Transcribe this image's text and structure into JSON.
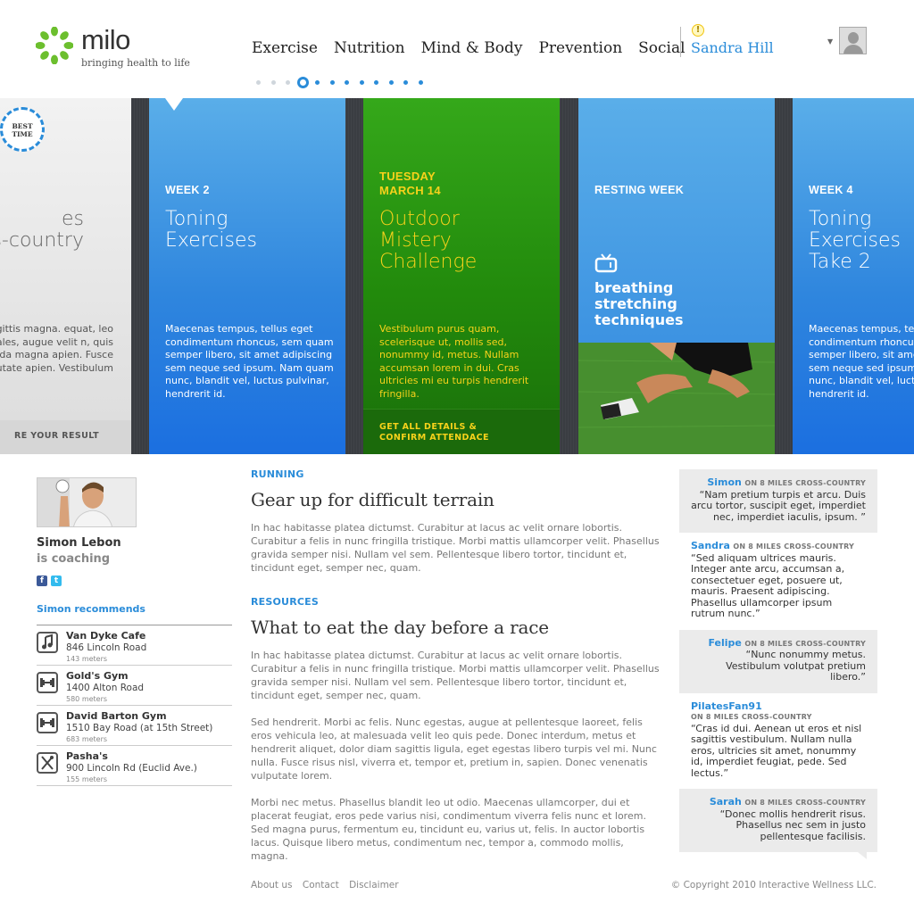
{
  "brand": {
    "name": "milo",
    "tagline": "bringing health to life",
    "accent": "#2a8cd9",
    "green": "#3aa315",
    "yellow": "#f7d21b"
  },
  "nav": {
    "items": [
      "Exercise",
      "Nutrition",
      "Mind & Body",
      "Prevention",
      "Social"
    ],
    "alert_icon": "warning-icon"
  },
  "user": {
    "name": "Sandra Hill"
  },
  "pager": {
    "total": 12,
    "current_index": 3
  },
  "carousel": {
    "cards": [
      {
        "badge": "BEST TIME",
        "title_line1": "es",
        "title_line2": "s-country",
        "desc": "dales sagittis magna. equat, leo eget o sodales, augue velit n, quis gravida magna apien. Fusce vulputate apien. Vestibulum",
        "footer": "RE YOUR RESULT"
      },
      {
        "label": "WEEK 2",
        "title": "Toning Exercises",
        "desc": "Maecenas tempus, tellus eget condimentum rhoncus, sem quam semper libero, sit amet adipiscing sem neque sed ipsum. Nam quam nunc, blandit vel, luctus pulvinar, hendrerit id."
      },
      {
        "label_line1": "TUESDAY",
        "label_line2": "MARCH 14",
        "title": "Outdoor Mistery Challenge",
        "desc": "Vestibulum purus quam, scelerisque ut, mollis sed, nonummy id, metus. Nullam accumsan lorem in dui. Cras ultricies mi eu turpis hendrerit fringilla.",
        "footer_line1": "GET ALL DETAILS &",
        "footer_line2": "CONFIRM ATTENDACE"
      },
      {
        "label": "RESTING WEEK",
        "title": "breathing stretching techniques",
        "icon": "tv-icon"
      },
      {
        "label": "WEEK 4",
        "title": "Toning Exercises Take 2",
        "desc": "Maecenas tempus, tellus eget condimentum rhoncus, sem quam semper libero, sit amet adipiscing sem neque sed ipsum. Nam quam nunc, blandit vel, luctus pulvinar, hendrerit id."
      }
    ]
  },
  "coach": {
    "name": "Simon Lebon",
    "role": "is coaching",
    "social": [
      "facebook-icon",
      "twitter-icon"
    ]
  },
  "recommendations": {
    "title": "Simon recommends",
    "items": [
      {
        "icon": "music-icon",
        "name": "Van Dyke Cafe",
        "address": "846 Lincoln Road",
        "distance": "143 meters"
      },
      {
        "icon": "dumbbell-icon",
        "name": "Gold's Gym",
        "address": "1400 Alton Road",
        "distance": "580 meters"
      },
      {
        "icon": "dumbbell-icon",
        "name": "David Barton Gym",
        "address": "1510 Bay Road (at 15th Street)",
        "distance": "683 meters"
      },
      {
        "icon": "utensils-icon",
        "name": "Pasha's",
        "address": "900 Lincoln Rd (Euclid Ave.)",
        "distance": "155 meters"
      }
    ]
  },
  "articles": [
    {
      "label": "RUNNING",
      "title": "Gear up for difficult terrain",
      "paragraphs": [
        "In hac habitasse platea dictumst. Curabitur at lacus ac velit ornare lobortis. Curabitur a felis in nunc fringilla tristique. Morbi mattis ullamcorper velit. Phasellus gravida semper nisi. Nullam vel sem. Pellentesque libero tortor, tincidunt et, tincidunt eget, semper nec, quam."
      ]
    },
    {
      "label": "RESOURCES",
      "title": "What to eat the day before a race",
      "paragraphs": [
        "In hac habitasse platea dictumst. Curabitur at lacus ac velit ornare lobortis. Curabitur a felis in nunc fringilla tristique. Morbi mattis ullamcorper velit. Phasellus gravida semper nisi. Nullam vel sem. Pellentesque libero tortor, tincidunt et, tincidunt eget, semper nec, quam.",
        "Sed hendrerit. Morbi ac felis. Nunc egestas, augue at pellentesque laoreet, felis eros vehicula leo, at malesuada velit leo quis pede. Donec interdum, metus et hendrerit aliquet, dolor diam sagittis ligula, eget egestas libero turpis vel mi. Nunc nulla. Fusce risus nisl, viverra et, tempor et, pretium in, sapien. Donec venenatis vulputate lorem.",
        "Morbi nec metus. Phasellus blandit leo ut odio. Maecenas ullamcorper, dui et placerat feugiat, eros pede varius nisi, condimentum viverra felis nunc et lorem. Sed magna purus, fermentum eu, tincidunt eu, varius ut, felis. In auctor lobortis lacus. Quisque libero metus, condimentum nec, tempor a, commodo mollis, magna."
      ]
    }
  ],
  "comments": [
    {
      "author": "Simon",
      "on": "ON 8 MILES CROSS-COUNTRY",
      "text": "“Nam pretium turpis et arcu. Duis arcu tortor, suscipit eget, imperdiet nec, imperdiet iaculis, ipsum. ”"
    },
    {
      "author": "Sandra",
      "on": "ON 8 MILES CROSS-COUNTRY",
      "text": "“Sed aliquam ultrices mauris. Integer ante arcu, accumsan a, consectetuer eget, posuere ut, mauris. Praesent adipiscing. Phasellus ullamcorper ipsum rutrum nunc.”"
    },
    {
      "author": "Felipe",
      "on": "ON 8 MILES CROSS-COUNTRY",
      "text": "“Nunc nonummy metus. Vestibulum volutpat pretium libero.”"
    },
    {
      "author": "PilatesFan91",
      "on": "ON 8 MILES CROSS-COUNTRY",
      "text": "“Cras id dui. Aenean ut eros et nisl sagittis vestibulum. Nullam nulla eros, ultricies sit amet, nonummy id, imperdiet feugiat, pede. Sed lectus.”"
    },
    {
      "author": "Sarah",
      "on": "ON 8 MILES CROSS-COUNTRY",
      "text": "“Donec mollis hendrerit risus. Phasellus nec sem in justo pellentesque facilisis."
    }
  ],
  "footer": {
    "links": [
      "About us",
      "Contact",
      "Disclaimer"
    ],
    "copyright": "© Copyright 2010 Interactive Wellness LLC."
  }
}
